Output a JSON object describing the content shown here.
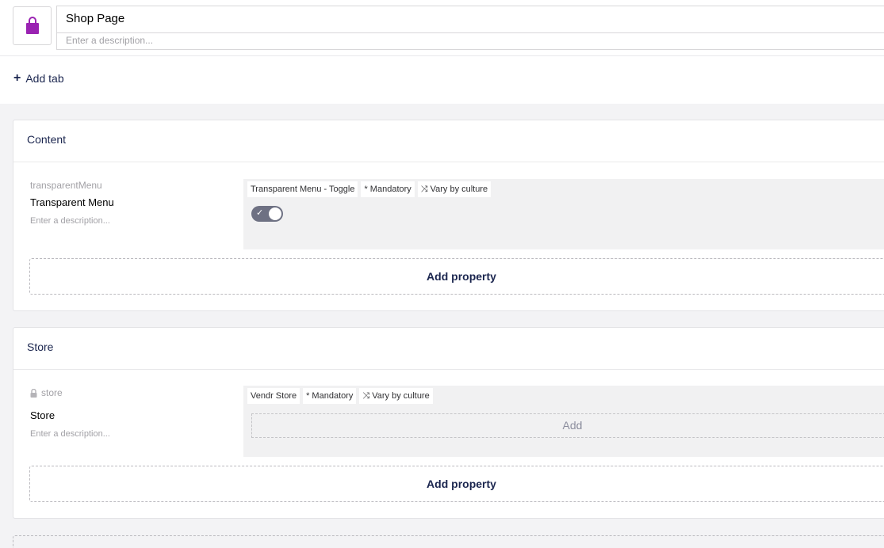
{
  "header": {
    "icon": "bag-icon",
    "icon_color": "#9a23b2",
    "name_value": "Shop Page",
    "description_placeholder": "Enter a description..."
  },
  "add_tab_label": "Add tab",
  "groups": [
    {
      "title": "Content",
      "property": {
        "alias": "transparentMenu",
        "locked": false,
        "label": "Transparent Menu",
        "description_placeholder": "Enter a description...",
        "tags": [
          "Transparent Menu - Toggle",
          "* Mandatory",
          "Vary by culture"
        ],
        "editor": "toggle",
        "toggle_on": true
      },
      "add_property_label": "Add property"
    },
    {
      "title": "Store",
      "property": {
        "alias": "store",
        "locked": true,
        "label": "Store",
        "description_placeholder": "Enter a description...",
        "tags": [
          "Vendr Store",
          "* Mandatory",
          "Vary by culture"
        ],
        "editor": "picker",
        "add_label": "Add"
      },
      "add_property_label": "Add property"
    }
  ]
}
